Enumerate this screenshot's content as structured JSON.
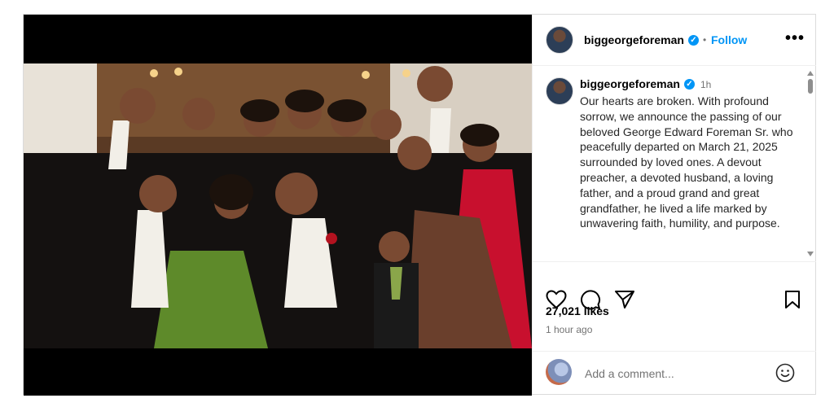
{
  "post": {
    "username": "biggeorgeforeman",
    "verified": true,
    "follow_label": "Follow",
    "separator": "•",
    "more_label": "•••"
  },
  "caption": {
    "username": "biggeorgeforeman",
    "time_ago": "1h",
    "text": "Our hearts are broken. With profound sorrow, we announce the passing of our beloved George Edward Foreman Sr. who peacefully departed on March 21, 2025 surrounded by loved ones. A devout preacher, a devoted husband, a loving father, and a proud grand and great grandfather, he lived a life marked by unwavering faith, humility, and purpose."
  },
  "actions": {
    "like_icon": "heart-icon",
    "comment_icon": "comment-icon",
    "share_icon": "send-icon",
    "save_icon": "bookmark-icon"
  },
  "stats": {
    "likes": "27,021 likes",
    "posted": "1 hour ago"
  },
  "comment_box": {
    "placeholder": "Add a comment...",
    "emoji_icon": "smiley-icon"
  },
  "colors": {
    "accent": "#0095f6",
    "muted": "#737373",
    "border": "#dbdbdb"
  }
}
